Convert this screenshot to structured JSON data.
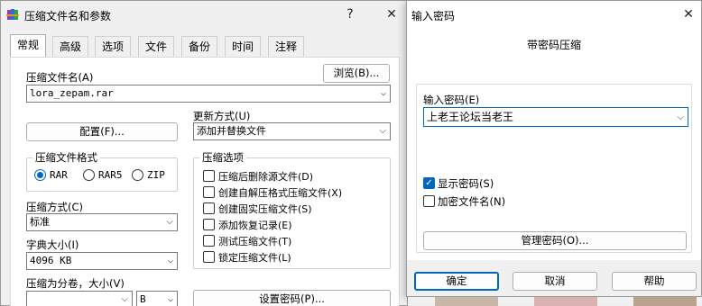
{
  "archive_dialog": {
    "title": "压缩文件名和参数",
    "help_glyph": "?",
    "close_glyph": "✕",
    "tabs": [
      "常规",
      "高级",
      "选项",
      "文件",
      "备份",
      "时间",
      "注释"
    ],
    "archive_name_label": "压缩文件名(A)",
    "archive_name_value": "lora_zepam.rar",
    "browse_button": "浏览(B)...",
    "profiles_button": "配置(F)...",
    "update_mode_label": "更新方式(U)",
    "update_mode_value": "添加并替换文件",
    "format_group_title": "压缩文件格式",
    "formats": [
      "RAR",
      "RAR5",
      "ZIP"
    ],
    "options_group_title": "压缩选项",
    "options": [
      {
        "label": "压缩后删除源文件(D)",
        "checked": false
      },
      {
        "label": "创建自解压格式压缩文件(X)",
        "checked": false
      },
      {
        "label": "创建固实压缩文件(S)",
        "checked": false
      },
      {
        "label": "添加恢复记录(E)",
        "checked": false
      },
      {
        "label": "测试压缩文件(T)",
        "checked": false
      },
      {
        "label": "锁定压缩文件(L)",
        "checked": false
      }
    ],
    "method_label": "压缩方式(C)",
    "method_value": "标准",
    "dict_label": "字典大小(I)",
    "dict_value": "4096 KB",
    "split_label": "压缩为分卷，大小(V)",
    "split_value": "",
    "split_unit": "B",
    "set_password_button": "设置密码(P)..."
  },
  "password_dialog": {
    "title": "输入密码",
    "close_glyph": "✕",
    "heading": "带密码压缩",
    "password_label": "输入密码(E)",
    "password_value": "上老王论坛当老王",
    "show_password_label": "显示密码(S)",
    "show_password_checked": true,
    "encrypt_names_label": "加密文件名(N)",
    "encrypt_names_checked": false,
    "organize_button": "管理密码(O)...",
    "ok_button": "确定",
    "cancel_button": "取消",
    "help_button": "帮助"
  },
  "icons": {
    "winrar": "winrar-books-icon",
    "check": "✓",
    "chevron": "⌵"
  }
}
